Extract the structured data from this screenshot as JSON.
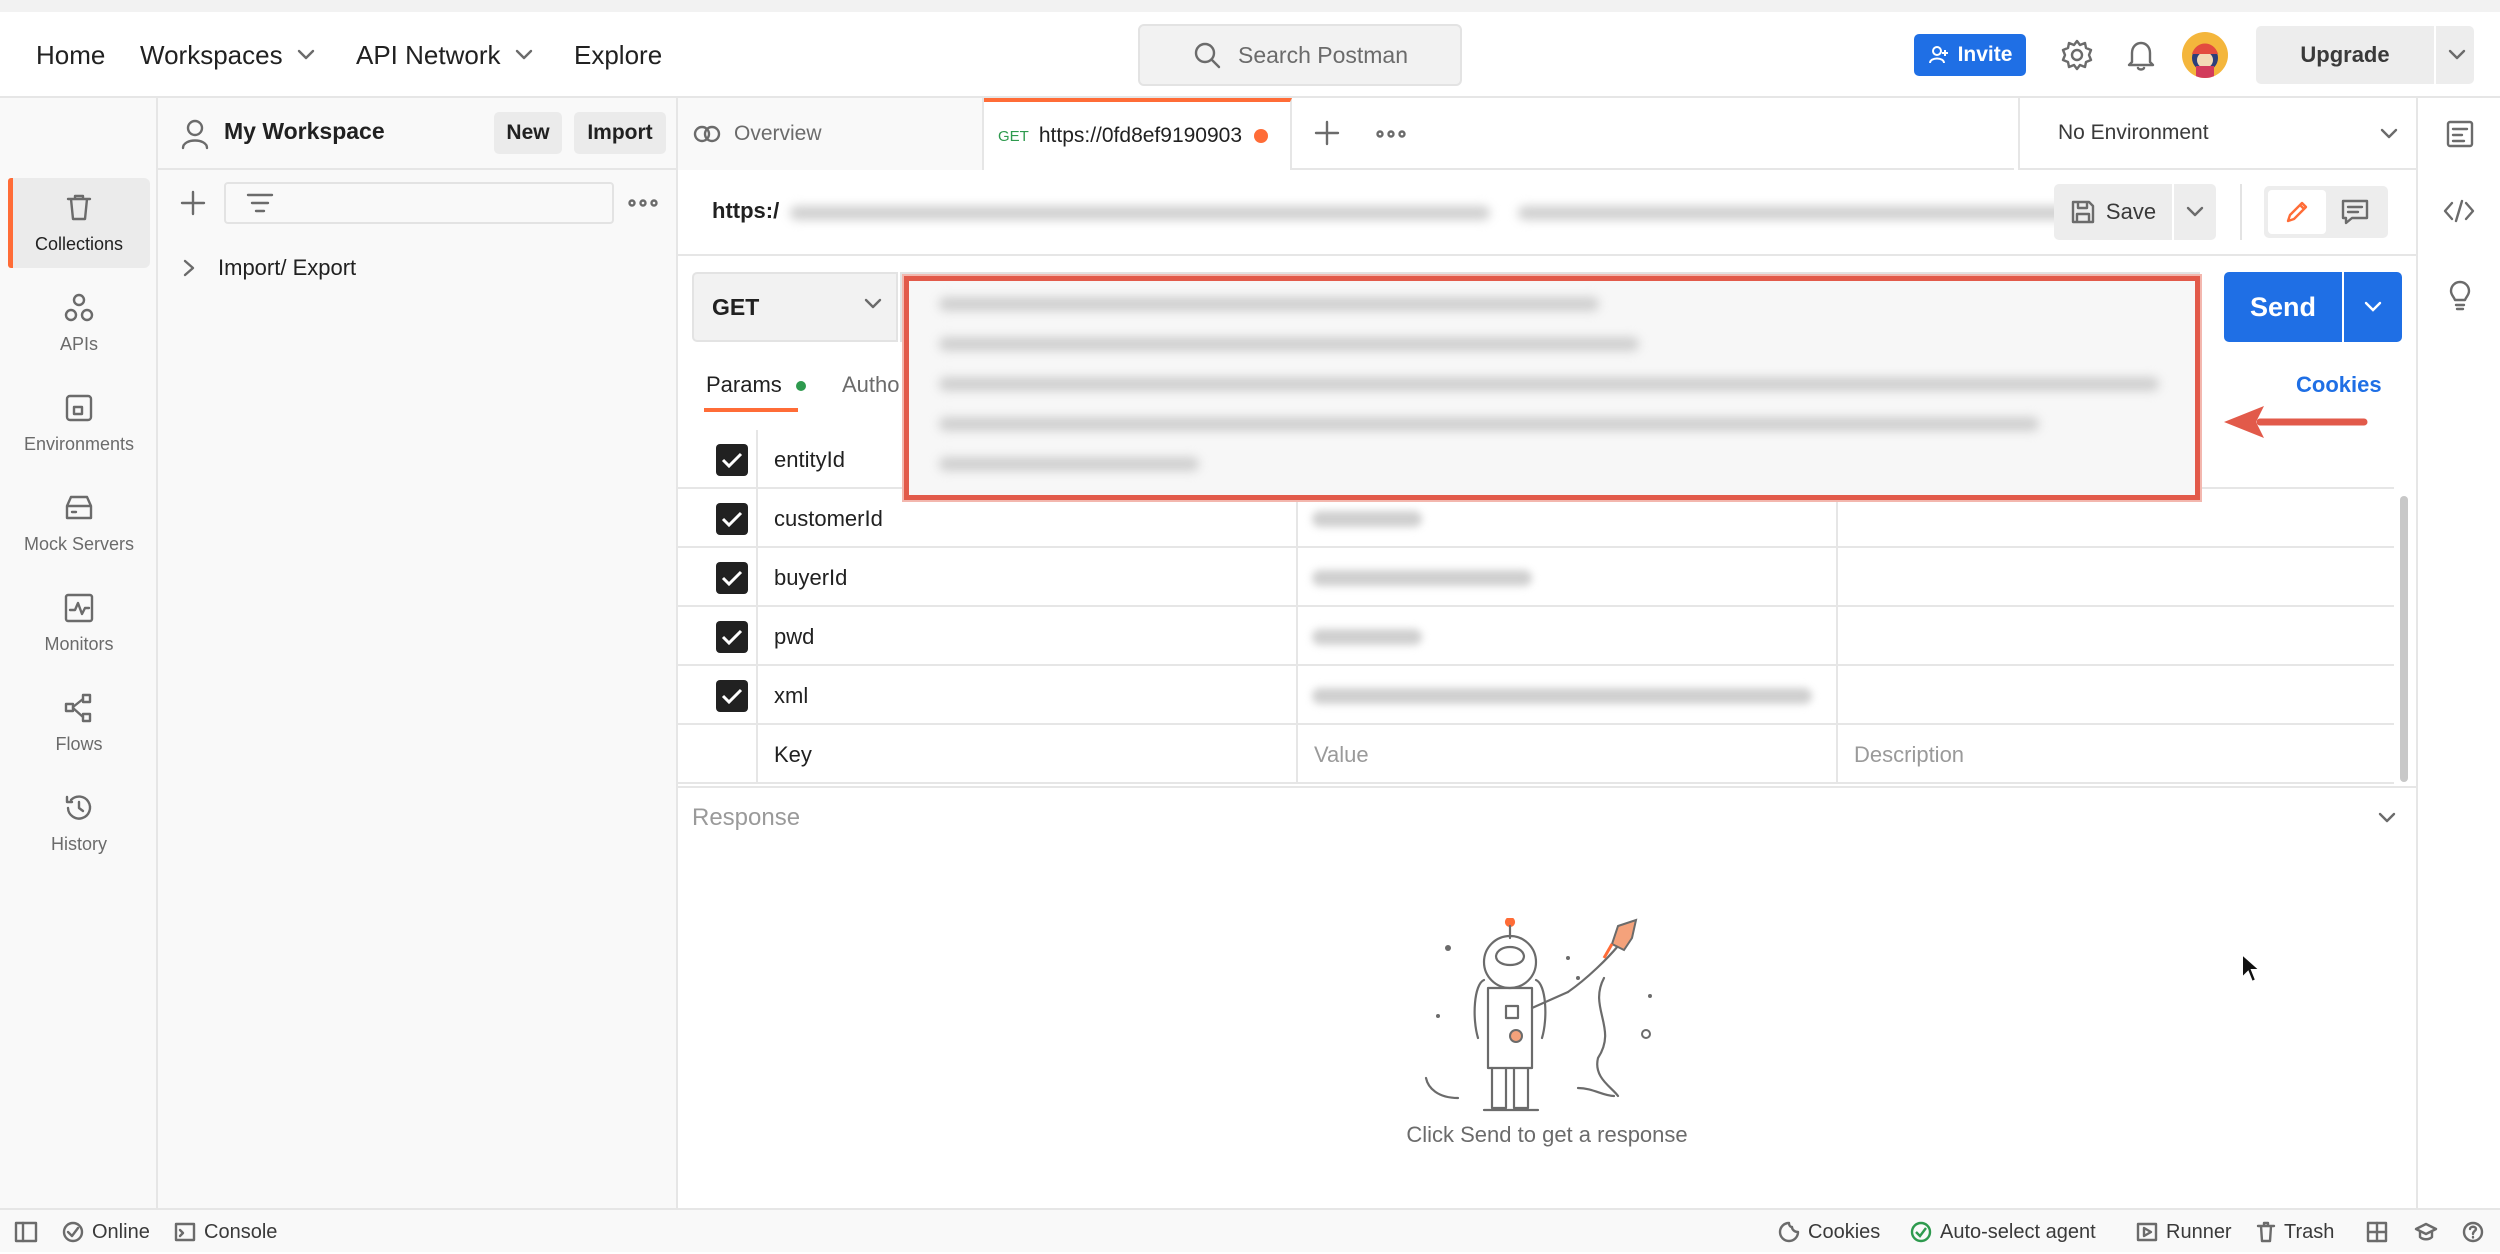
{
  "header": {
    "nav": [
      "Home",
      "Workspaces",
      "API Network",
      "Explore"
    ],
    "search_placeholder": "Search Postman",
    "invite_label": "Invite",
    "upgrade_label": "Upgrade",
    "accent_color": "#ff6c37",
    "primary_color": "#1f6fe5"
  },
  "rail": {
    "items": [
      "Collections",
      "APIs",
      "Environments",
      "Mock Servers",
      "Monitors",
      "Flows",
      "History"
    ],
    "icons": [
      "trash-can-icon",
      "apis-icon",
      "environments-icon",
      "mock-server-icon",
      "monitor-icon",
      "flows-icon",
      "history-icon"
    ]
  },
  "sidebar": {
    "workspace_name": "My Workspace",
    "new_label": "New",
    "import_label": "Import",
    "tree": [
      {
        "label": "Import/ Export"
      }
    ]
  },
  "tabs": {
    "overview_label": "Overview",
    "active_method": "GET",
    "active_title": "https://0fd8ef9190903"
  },
  "environment": {
    "selected": "No Environment"
  },
  "request": {
    "url_prefix": "https:/",
    "save_label": "Save",
    "method": "GET",
    "send_label": "Send",
    "subtabs": {
      "params": "Params",
      "auth_partial": "Autho",
      "cookies": "Cookies"
    },
    "params": [
      {
        "key": "entityId",
        "checked": true
      },
      {
        "key": "customerId",
        "checked": true
      },
      {
        "key": "buyerId",
        "checked": true
      },
      {
        "key": "pwd",
        "checked": true
      },
      {
        "key": "xml",
        "checked": true
      }
    ],
    "placeholders": {
      "key": "Key",
      "value": "Value",
      "description": "Description"
    }
  },
  "response": {
    "title": "Response",
    "empty_message": "Click Send to get a response"
  },
  "statusbar": {
    "online": "Online",
    "console": "Console",
    "cookies": "Cookies",
    "agent": "Auto-select agent",
    "runner": "Runner",
    "trash": "Trash"
  }
}
